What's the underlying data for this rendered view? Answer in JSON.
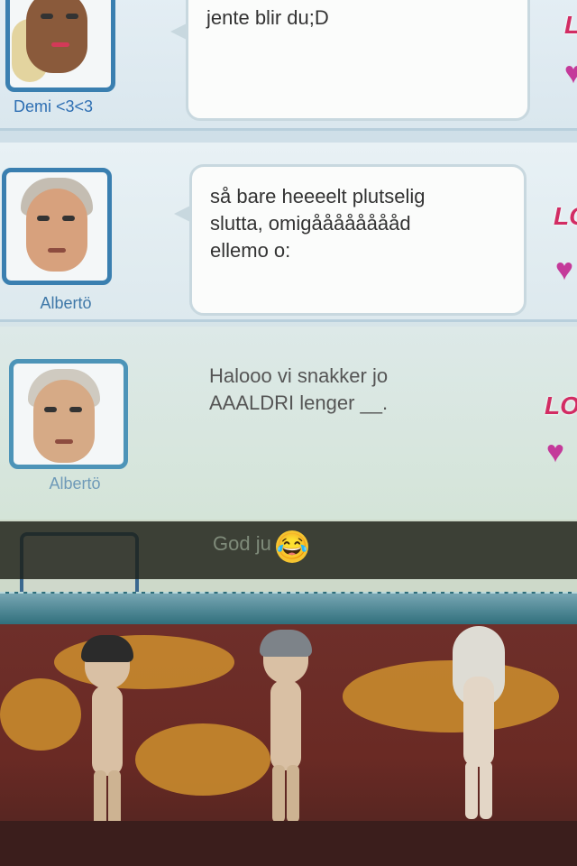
{
  "messages": [
    {
      "sender": "Demi <3<3",
      "text": "jente blir du;D"
    },
    {
      "sender": "Albertö",
      "text": "så bare heeeelt plutselig\nslutta, omigååååååååd\nellemo o:"
    },
    {
      "sender": "Albertö",
      "text": "Halooo vi snakker jo\nAAALDRI lenger __."
    }
  ],
  "partial_message": {
    "text": "God ju"
  },
  "badges": {
    "love_label": "LO"
  },
  "icons": {
    "heart": "heart-icon",
    "emoji": "tears-of-joy-emoji"
  },
  "colors": {
    "accent_blue": "#3a7fb0",
    "heart": "#c43a9a",
    "badge": "#d22c63",
    "room_floor": "#6e2f2a"
  }
}
